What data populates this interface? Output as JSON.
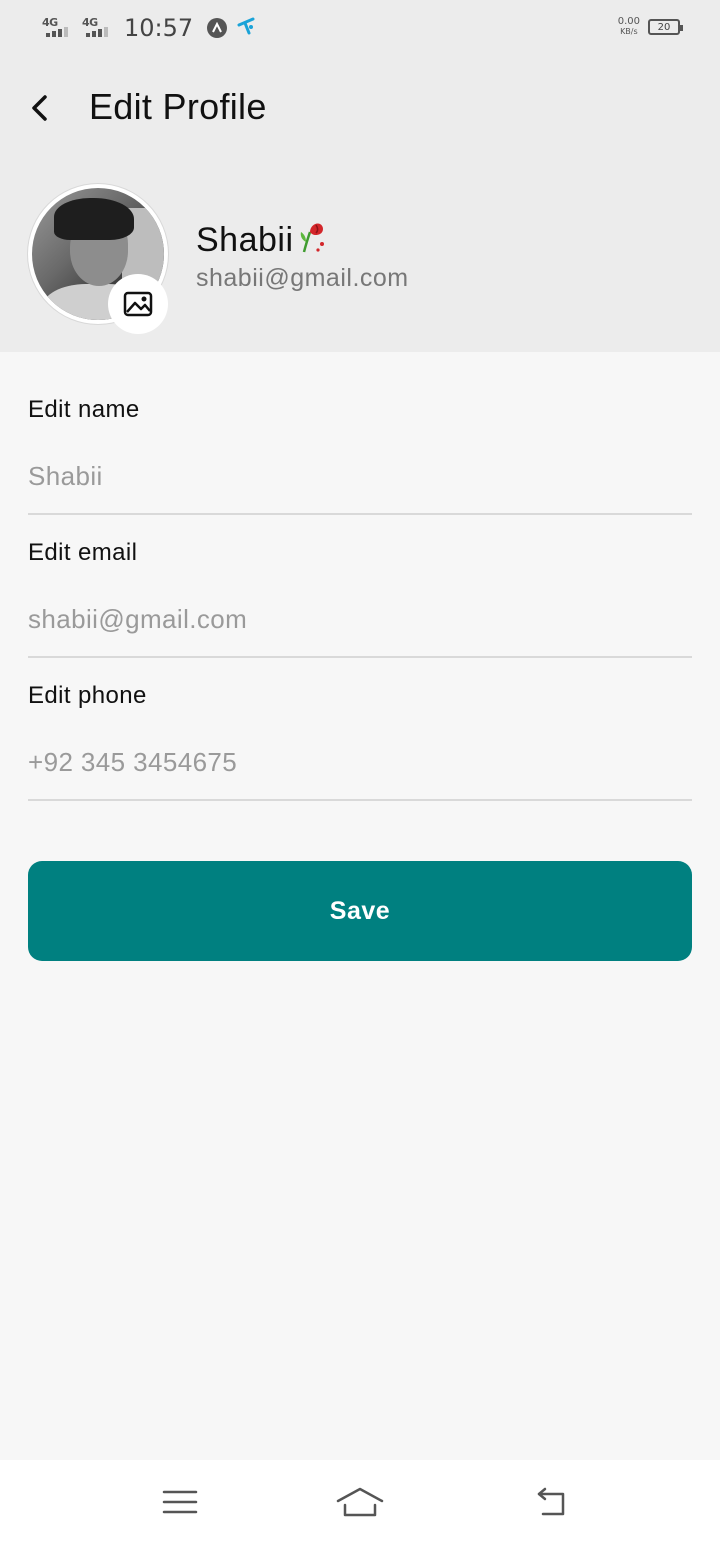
{
  "status_bar": {
    "network_1": "4G",
    "network_2": "4G",
    "time": "10:57",
    "speed_value": "0.00",
    "speed_unit": "KB/s",
    "battery_level": "20"
  },
  "header": {
    "title": "Edit Profile",
    "back_icon": "chevron-left-icon"
  },
  "profile": {
    "name": "Shabii",
    "email": "shabii@gmail.com",
    "photo_button_icon": "image-icon"
  },
  "form": {
    "name": {
      "label": "Edit name",
      "placeholder": "Shabii",
      "value": ""
    },
    "email": {
      "label": "Edit email",
      "placeholder": "shabii@gmail.com",
      "value": ""
    },
    "phone": {
      "label": "Edit phone",
      "placeholder": "+92 345 3454675",
      "value": ""
    }
  },
  "save_button": {
    "label": "Save"
  },
  "colors": {
    "accent": "#008080",
    "header_bg": "#ececec",
    "page_bg": "#f7f7f7"
  },
  "nav_bar": {
    "menu_icon": "menu-icon",
    "home_icon": "home-icon",
    "back_icon": "back-icon"
  }
}
